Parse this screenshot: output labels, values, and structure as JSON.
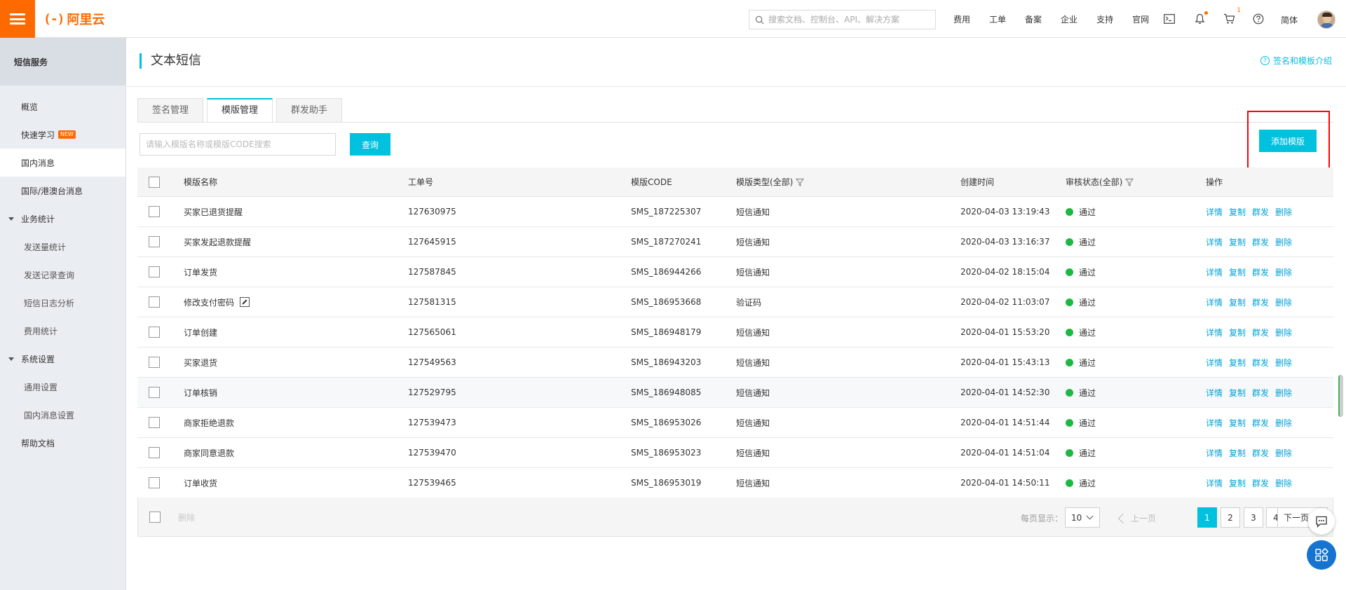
{
  "topbar": {
    "logo_text": "阿里云",
    "search_placeholder": "搜索文档、控制台、API、解决方案",
    "nav": [
      "费用",
      "工单",
      "备案",
      "企业",
      "支持",
      "官网"
    ],
    "cart_count": "1",
    "language": "简体"
  },
  "sidebar": {
    "title": "短信服务",
    "overview": "概览",
    "quick_learn": "快速学习",
    "new_badge": "NEW",
    "domestic": "国内消息",
    "intl": "国际/港澳台消息",
    "biz_stats": "业务统计",
    "send_stats": "发送量统计",
    "send_records": "发送记录查询",
    "log_analysis": "短信日志分析",
    "fee_stats": "费用统计",
    "sys_settings": "系统设置",
    "general_settings": "通用设置",
    "domestic_settings": "国内消息设置",
    "help_docs": "帮助文档"
  },
  "header": {
    "title": "文本短信",
    "intro_link": "签名和模板介绍"
  },
  "tabs": [
    "签名管理",
    "模版管理",
    "群发助手"
  ],
  "search": {
    "placeholder": "请输入模版名称或模版CODE搜索",
    "query_label": "查询",
    "add_label": "添加模版"
  },
  "table": {
    "columns": {
      "name": "模版名称",
      "order": "工单号",
      "code": "模版CODE",
      "type": "模版类型(全部)",
      "time": "创建时间",
      "status": "审核状态(全部)",
      "ops": "操作"
    },
    "rows": [
      {
        "name": "买家已退货提醒",
        "order": "127630975",
        "code": "SMS_187225307",
        "type": "短信通知",
        "time": "2020-04-03 13:19:43",
        "status": "通过"
      },
      {
        "name": "买家发起退款提醒",
        "order": "127645915",
        "code": "SMS_187270241",
        "type": "短信通知",
        "time": "2020-04-03 13:16:37",
        "status": "通过"
      },
      {
        "name": "订单发货",
        "order": "127587845",
        "code": "SMS_186944266",
        "type": "短信通知",
        "time": "2020-04-02 18:15:04",
        "status": "通过"
      },
      {
        "name": "修改支付密码",
        "order": "127581315",
        "code": "SMS_186953668",
        "type": "验证码",
        "time": "2020-04-02 11:03:07",
        "status": "通过"
      },
      {
        "name": "订单创建",
        "order": "127565061",
        "code": "SMS_186948179",
        "type": "短信通知",
        "time": "2020-04-01 15:53:20",
        "status": "通过"
      },
      {
        "name": "买家退货",
        "order": "127549563",
        "code": "SMS_186943203",
        "type": "短信通知",
        "time": "2020-04-01 15:43:13",
        "status": "通过"
      },
      {
        "name": "订单核销",
        "order": "127529795",
        "code": "SMS_186948085",
        "type": "短信通知",
        "time": "2020-04-01 14:52:30",
        "status": "通过"
      },
      {
        "name": "商家拒绝退款",
        "order": "127539473",
        "code": "SMS_186953026",
        "type": "短信通知",
        "time": "2020-04-01 14:51:44",
        "status": "通过"
      },
      {
        "name": "商家同意退款",
        "order": "127539470",
        "code": "SMS_186953023",
        "type": "短信通知",
        "time": "2020-04-01 14:51:04",
        "status": "通过"
      },
      {
        "name": "订单收货",
        "order": "127539465",
        "code": "SMS_186953019",
        "type": "短信通知",
        "time": "2020-04-01 14:50:11",
        "status": "通过"
      }
    ],
    "ops": [
      "详情",
      "复制",
      "群发",
      "删除"
    ]
  },
  "footer": {
    "delete_label": "删除",
    "per_page_label": "每页显示：",
    "per_page_value": "10",
    "prev_label": "上一页",
    "pages": [
      "1",
      "2",
      "3",
      "4"
    ],
    "next_label": "下一页"
  },
  "colors": {
    "accent": "#00c1de",
    "brand": "#ff6a00",
    "status_ok": "#1fb743"
  }
}
